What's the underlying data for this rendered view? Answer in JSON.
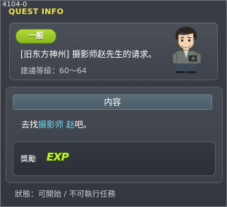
{
  "window": {
    "quest_id": "4104-0",
    "title": "QUEST INFO"
  },
  "quest": {
    "category": "一般",
    "name": "[旧东方神州] 摄影师赵先生的请求。",
    "required_level": "建議等級：60～64"
  },
  "content": {
    "header": "内容",
    "text_prefix": "去找",
    "npc_name": "摄影师 赵",
    "text_suffix": "吧。"
  },
  "reward": {
    "label": "獎勵",
    "icon_label": "EXP"
  },
  "status": {
    "text": "狀態：可開始 / 不可執行任務"
  }
}
